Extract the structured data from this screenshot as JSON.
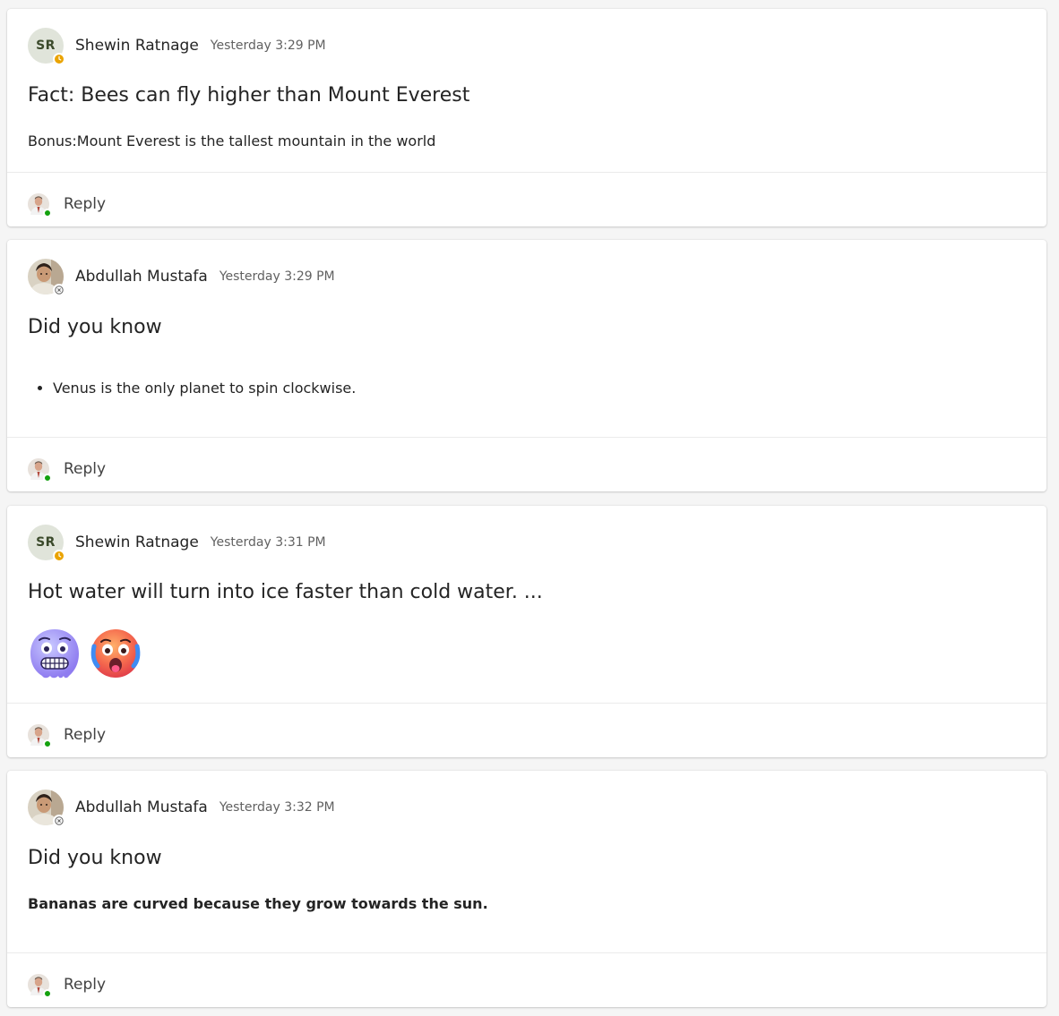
{
  "posts": [
    {
      "author": "Shewin Ratnage",
      "initials": "SR",
      "timestamp": "Yesterday 3:29 PM",
      "subject": "Fact: Bees can fly higher than Mount Everest",
      "body": "Bonus:Mount Everest is the tallest mountain in the world",
      "presence": "away",
      "reply_label": "Reply"
    },
    {
      "author": "Abdullah Mustafa",
      "timestamp": "Yesterday 3:29 PM",
      "subject": "Did you know",
      "bullets": [
        "Venus is the only planet to spin clockwise."
      ],
      "presence": "offline",
      "reply_label": "Reply"
    },
    {
      "author": "Shewin Ratnage",
      "initials": "SR",
      "timestamp": "Yesterday 3:31 PM",
      "subject": "Hot water will turn into ice faster than cold water. ...",
      "emojis": [
        "cold-face-emoji",
        "hot-face-emoji"
      ],
      "presence": "away",
      "reply_label": "Reply"
    },
    {
      "author": "Abdullah Mustafa",
      "timestamp": "Yesterday 3:32 PM",
      "subject": "Did you know",
      "body": "Bananas are curved because they grow towards the sun.",
      "presence": "offline",
      "reply_label": "Reply"
    }
  ],
  "colors": {
    "away": "#eaa300",
    "available": "#13a10e",
    "initials_bg": "#e0e4da"
  }
}
